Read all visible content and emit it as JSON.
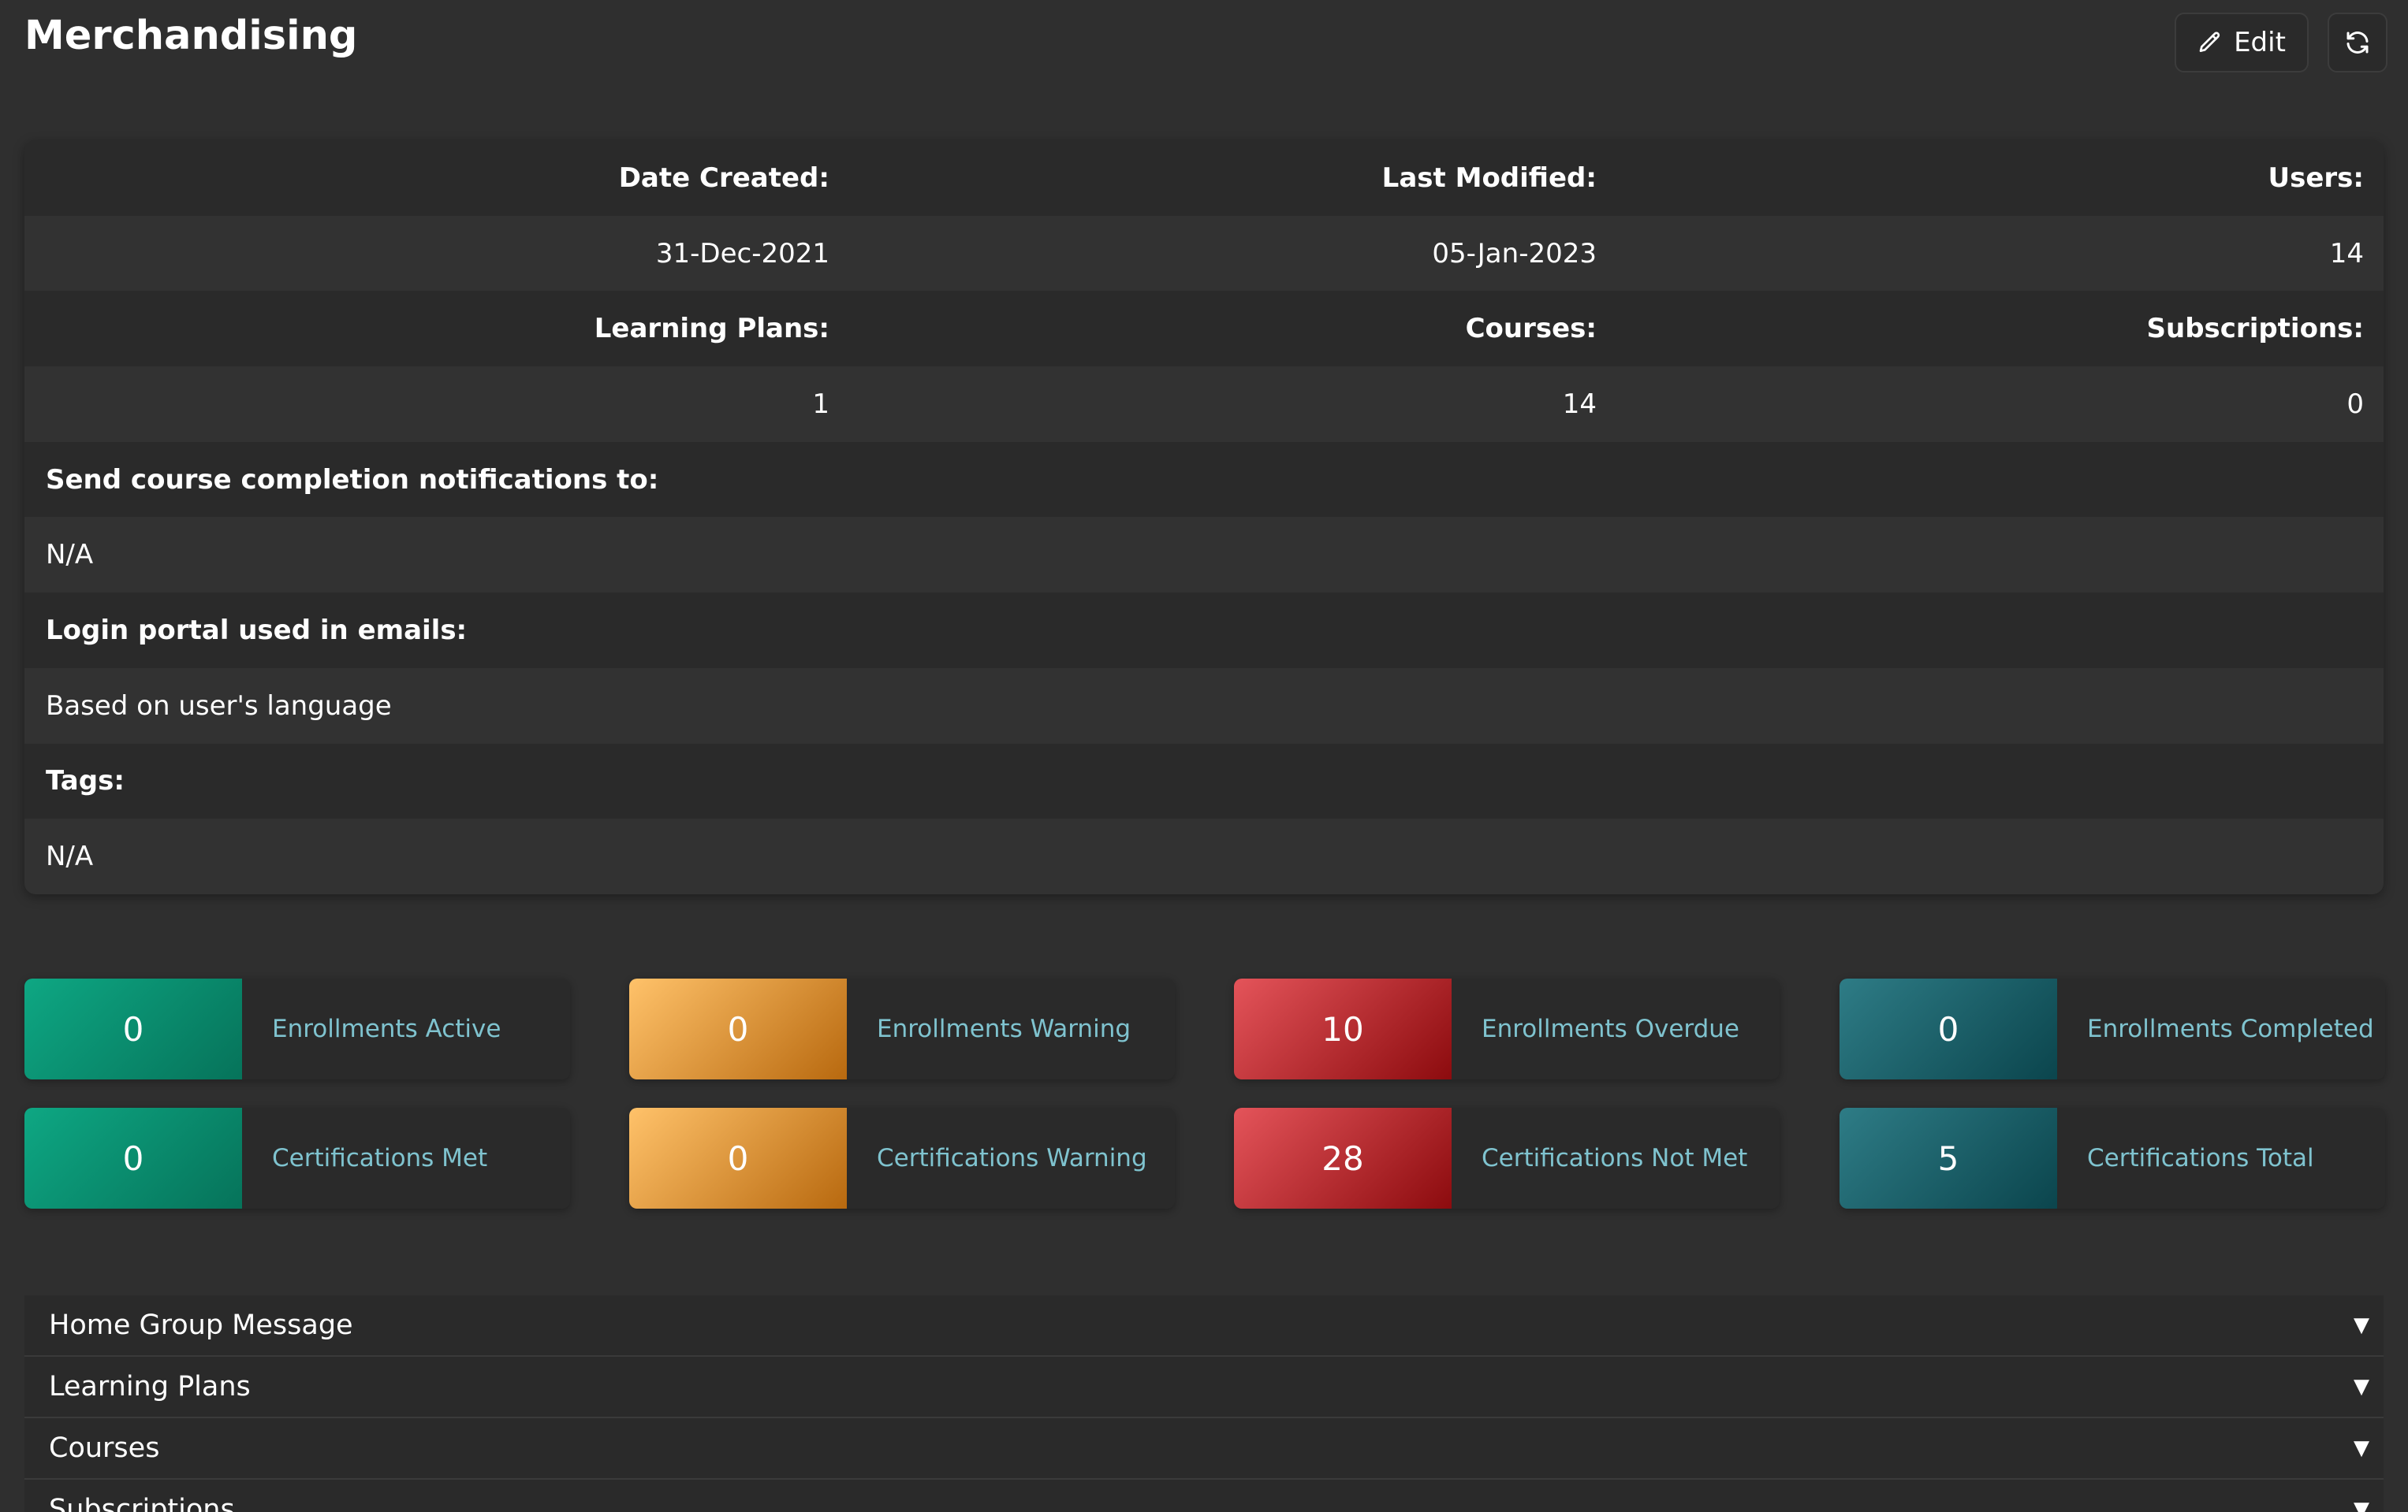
{
  "header": {
    "title": "Merchandising",
    "edit_label": "Edit"
  },
  "info": {
    "date_created_label": "Date Created:",
    "last_modified_label": "Last Modified:",
    "users_label": "Users:",
    "date_created": "31-Dec-2021",
    "last_modified": "05-Jan-2023",
    "users": "14",
    "learning_plans_label": "Learning Plans:",
    "courses_label": "Courses:",
    "subscriptions_label": "Subscriptions:",
    "learning_plans": "1",
    "courses": "14",
    "subscriptions": "0",
    "notifications_label": "Send course completion notifications to:",
    "notifications_value": "N/A",
    "login_portal_label": "Login portal used in emails:",
    "login_portal_value": "Based on user's language",
    "tags_label": "Tags:",
    "tags_value": "N/A"
  },
  "stats": [
    {
      "value": "0",
      "label": "Enrollments Active",
      "color": "#0ea783"
    },
    {
      "value": "0",
      "label": "Enrollments Warning",
      "color": "#f4a940"
    },
    {
      "value": "10",
      "label": "Enrollments Overdue",
      "color": "#d6373d"
    },
    {
      "value": "0",
      "label": "Enrollments Completed",
      "color": "#1f6b75"
    },
    {
      "value": "0",
      "label": "Certifications Met",
      "color": "#0ea783"
    },
    {
      "value": "0",
      "label": "Certifications Warning",
      "color": "#f4a940"
    },
    {
      "value": "28",
      "label": "Certifications Not Met",
      "color": "#d6373d"
    },
    {
      "value": "5",
      "label": "Certifications Total",
      "color": "#1f6b75"
    }
  ],
  "accordion": [
    {
      "label": "Home Group Message",
      "icon": "caret-down-icon"
    },
    {
      "label": "Learning Plans",
      "icon": "caret-down-icon"
    },
    {
      "label": "Courses",
      "icon": "caret-down-icon"
    },
    {
      "label": "Subscriptions",
      "icon": "caret-down-icon"
    }
  ],
  "colors": {
    "background": "#2f2f2f",
    "card": "#2a2a2a",
    "label_accent": "#7fc3cf"
  }
}
